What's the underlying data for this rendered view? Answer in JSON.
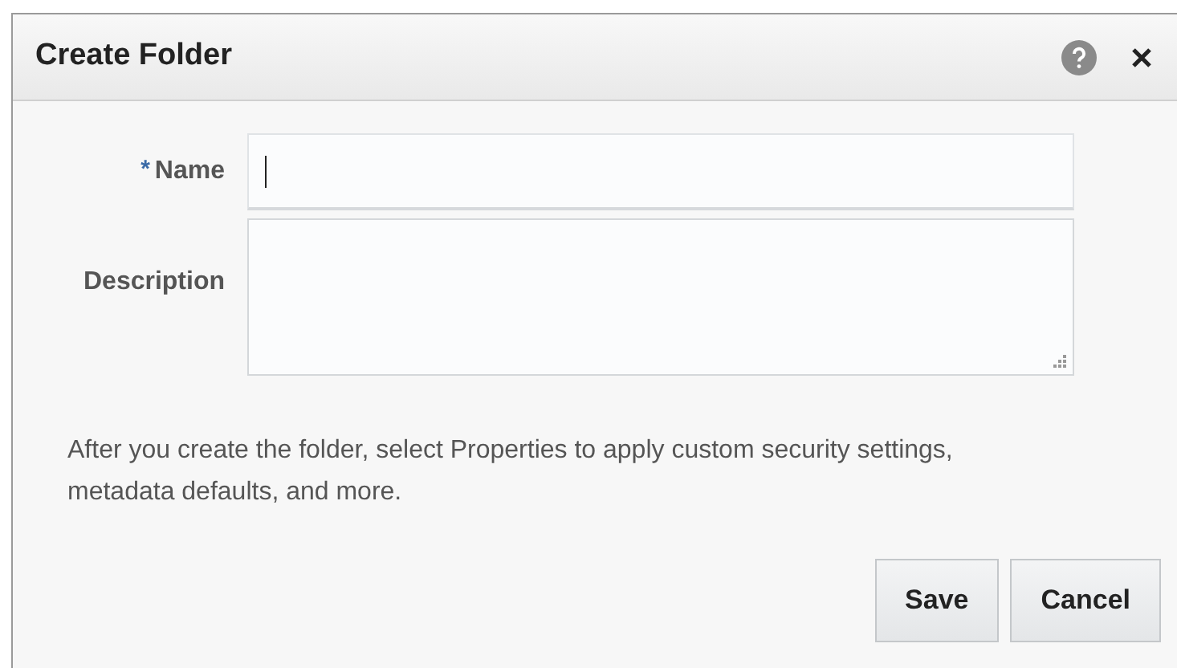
{
  "dialog": {
    "title": "Create Folder"
  },
  "fields": [
    {
      "kind": "input",
      "label": "Name",
      "required_mark": "*",
      "focused": true
    },
    {
      "kind": "textarea",
      "label": "Description",
      "focused": false
    }
  ],
  "note": "After you create the folder, select Properties to apply custom security settings, metadata defaults, and more.",
  "buttons": [
    "Save",
    "Cancel"
  ]
}
